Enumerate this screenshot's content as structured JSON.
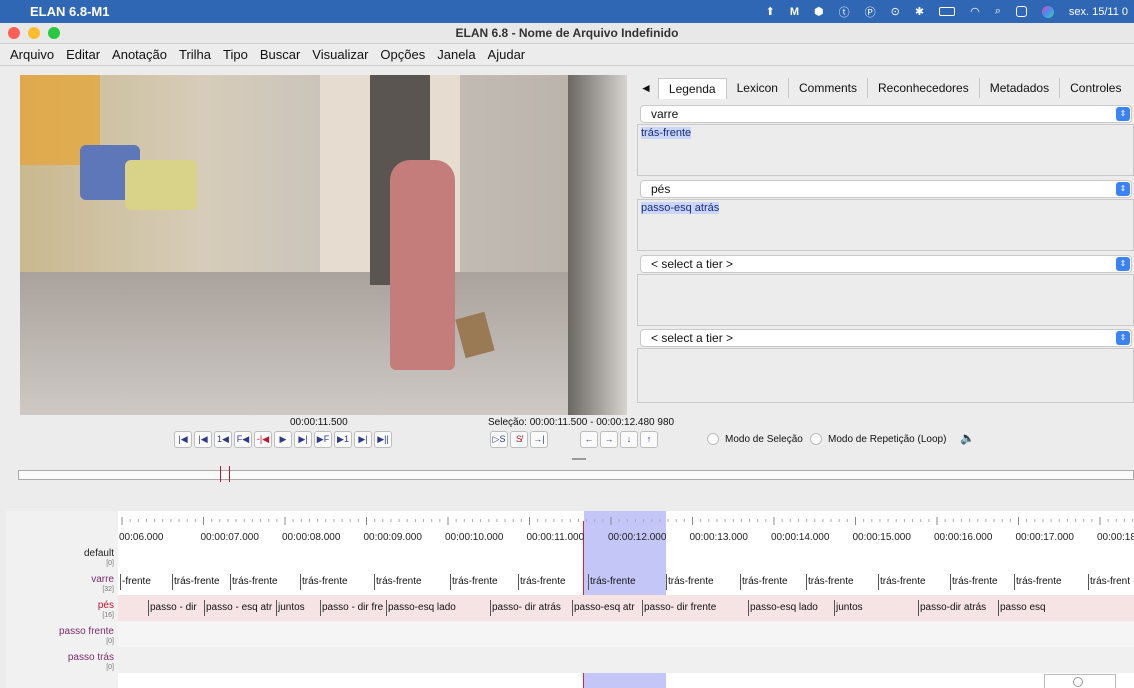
{
  "macbar": {
    "app_name": "ELAN 6.8-M1",
    "clock": "sex. 15/11 0"
  },
  "window": {
    "title": "ELAN 6.8 - Nome de Arquivo Indefinido"
  },
  "menu": [
    "Arquivo",
    "Editar",
    "Anotação",
    "Trilha",
    "Tipo",
    "Buscar",
    "Visualizar",
    "Opções",
    "Janela",
    "Ajudar"
  ],
  "tabs": {
    "arrow": "◄",
    "items": [
      "Legenda",
      "Lexicon",
      "Comments",
      "Reconhecedores",
      "Metadados",
      "Controles"
    ],
    "selected": "Legenda"
  },
  "subtitle_panels": [
    {
      "tier": "varre",
      "text": "trás-frente"
    },
    {
      "tier": "pés",
      "text": "passo-esq atrás"
    },
    {
      "tier": "< select a tier >",
      "text": ""
    },
    {
      "tier": "< select a tier >",
      "text": ""
    }
  ],
  "media": {
    "time": "00:00:11.500",
    "selection": "Seleção: 00:00:11.500 - 00:00:12.480 980",
    "selection_mode_label": "Modo de Seleção",
    "loop_mode_label": "Modo de Repetição (Loop)",
    "nav_buttons": [
      "|◀",
      "|◀",
      "1◀",
      "F◀",
      "-|◀",
      "▶",
      "▶|",
      "▶F",
      "▶1",
      "▶|",
      "▶||"
    ],
    "sel_buttons": [
      "▷S",
      "S̸",
      "→|"
    ],
    "arrow_buttons": [
      "←",
      "→",
      "↓",
      "↑"
    ]
  },
  "ruler": {
    "labels": [
      "00:06.000",
      "00:00:07.000",
      "00:00:08.000",
      "00:00:09.000",
      "00:00:10.000",
      "00:00:11.000",
      "00:00:12.000",
      "00:00:13.000",
      "00:00:14.000",
      "00:00:15.000",
      "00:00:16.000",
      "00:00:17.000",
      "00:00:18.0"
    ]
  },
  "tiers": [
    {
      "name": "default",
      "count": "[0]",
      "color": "#222222"
    },
    {
      "name": "varre",
      "count": "[32]",
      "color": "#7a2c6a"
    },
    {
      "name": "pés",
      "count": "[16]",
      "color": "#c0152f"
    },
    {
      "name": "passo frente",
      "count": "[0]",
      "color": "#7a2c6a"
    },
    {
      "name": "passo trás",
      "count": "[0]",
      "color": "#7a2c6a"
    }
  ],
  "varre_annotations": [
    "-frente",
    "trás-frente",
    "trás-frente",
    "trás-frente",
    "trás-frente",
    "trás-frente",
    "trás-frente",
    "trás-frente",
    "trás-frente",
    "trás-frente",
    "trás-frente",
    "trás-frente",
    "trás-frente",
    "trás-frente",
    "trás-frent"
  ],
  "pes_annotations": [
    "passo - dir",
    "passo - esq atr",
    "juntos",
    "passo - dir fre",
    "passo-esq lado",
    "passo- dir atrás",
    "passo-esq atr",
    "passo- dir frente",
    "passo-esq lado",
    "juntos",
    "passo-dir atrás",
    "passo esq"
  ],
  "colors": {
    "selection": "#c4c6f7",
    "crosshair": "#e0232b",
    "pes_row": "#f6e3e3",
    "accent": "#3b82f6"
  }
}
